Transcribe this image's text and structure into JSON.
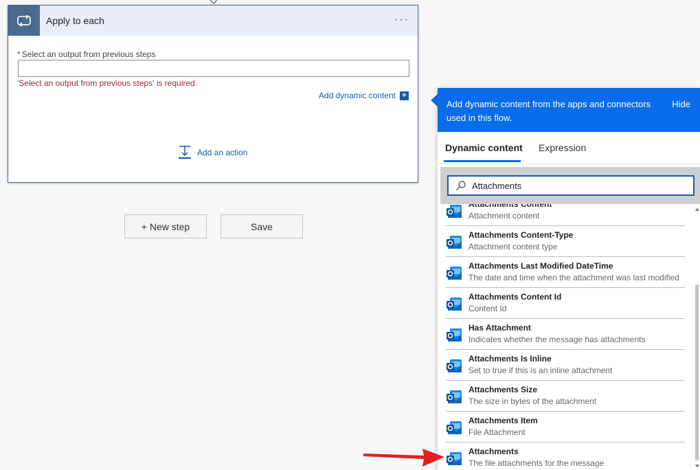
{
  "card": {
    "title": "Apply to each",
    "more_label": "···",
    "field_label": "Select an output from previous steps",
    "required_mark": "*",
    "field_value": "",
    "error": "'Select an output from previous steps' is required.",
    "add_dynamic": "Add dynamic content",
    "add_action": "Add an action"
  },
  "buttons": {
    "new_step": "+ New step",
    "save": "Save"
  },
  "panel": {
    "header": "Add dynamic content from the apps and connectors used in this flow.",
    "hide": "Hide",
    "tabs": [
      {
        "label": "Dynamic content",
        "active": true
      },
      {
        "label": "Expression",
        "active": false
      }
    ],
    "search_value": "Attachments",
    "items": [
      {
        "title": "Attachments Content",
        "desc": "Attachment content"
      },
      {
        "title": "Attachments Content-Type",
        "desc": "Attachment content type"
      },
      {
        "title": "Attachments Last Modified DateTime",
        "desc": "The date and time when the attachment was last modified"
      },
      {
        "title": "Attachments Content Id",
        "desc": "Content Id"
      },
      {
        "title": "Has Attachment",
        "desc": "Indicates whether the message has attachments"
      },
      {
        "title": "Attachments Is Inline",
        "desc": "Set to true if this is an inline attachment"
      },
      {
        "title": "Attachments Size",
        "desc": "The size in bytes of the attachment"
      },
      {
        "title": "Attachments Item",
        "desc": "File Attachment"
      },
      {
        "title": "Attachments",
        "desc": "The file attachments for the message"
      }
    ]
  },
  "icons": {
    "loop": "loop-icon",
    "outlook": "outlook-icon",
    "search": "search-icon",
    "add_action": "add-action-icon"
  },
  "colors": {
    "accent": "#0a6ce8",
    "card_header": "#4a6a8f",
    "link": "#1a5aa6",
    "error": "#a4262c",
    "arrow": "#e02020"
  }
}
